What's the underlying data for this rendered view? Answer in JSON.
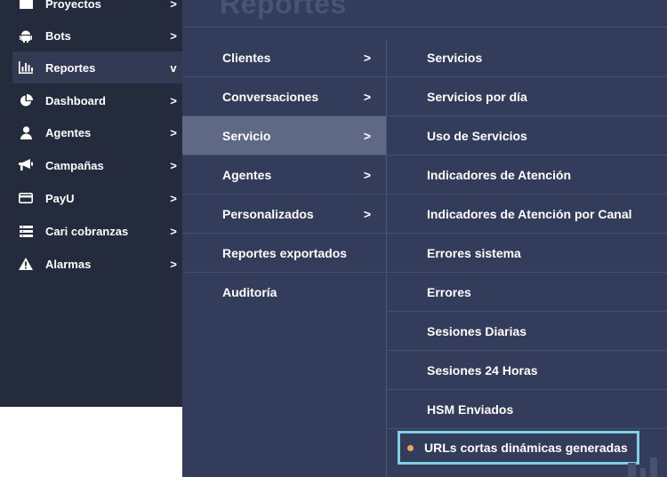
{
  "sidebar": {
    "items": [
      {
        "label": "Proyectos",
        "icon": "folder-icon",
        "chevron": ">"
      },
      {
        "label": "Bots",
        "icon": "android-icon",
        "chevron": ">"
      },
      {
        "label": "Reportes",
        "icon": "bar-chart-icon",
        "chevron": "v"
      },
      {
        "label": "Dashboard",
        "icon": "pie-chart-icon",
        "chevron": ">"
      },
      {
        "label": "Agentes",
        "icon": "user-icon",
        "chevron": ">"
      },
      {
        "label": "Campañas",
        "icon": "megaphone-icon",
        "chevron": ">"
      },
      {
        "label": "PayU",
        "icon": "credit-card-icon",
        "chevron": ">"
      },
      {
        "label": "Cari cobranzas",
        "icon": "list-icon",
        "chevron": ">"
      },
      {
        "label": "Alarmas",
        "icon": "warning-icon",
        "chevron": ">"
      }
    ]
  },
  "panel": {
    "title": "Reportes",
    "menu": [
      {
        "label": "Clientes",
        "chevron": ">"
      },
      {
        "label": "Conversaciones",
        "chevron": ">"
      },
      {
        "label": "Servicio",
        "chevron": ">"
      },
      {
        "label": "Agentes",
        "chevron": ">"
      },
      {
        "label": "Personalizados",
        "chevron": ">"
      },
      {
        "label": "Reportes exportados",
        "chevron": ""
      },
      {
        "label": "Auditoría",
        "chevron": ""
      }
    ],
    "submenu": [
      {
        "label": "Servicios"
      },
      {
        "label": "Servicios por día"
      },
      {
        "label": "Uso de Servicios"
      },
      {
        "label": "Indicadores de Atención"
      },
      {
        "label": "Indicadores de Atención por Canal"
      },
      {
        "label": "Errores sistema"
      },
      {
        "label": "Errores"
      },
      {
        "label": "Sesiones Diarias"
      },
      {
        "label": "Sesiones 24 Horas"
      },
      {
        "label": "HSM Enviados"
      },
      {
        "label": "URLs cortas dinámicas generadas"
      }
    ]
  },
  "colors": {
    "sidebar_bg": "#242b3d",
    "panel_bg": "#343c5b",
    "active_menu_bg": "#5f6885",
    "highlight_border": "#7fd0e2",
    "bullet": "#f0a850"
  }
}
